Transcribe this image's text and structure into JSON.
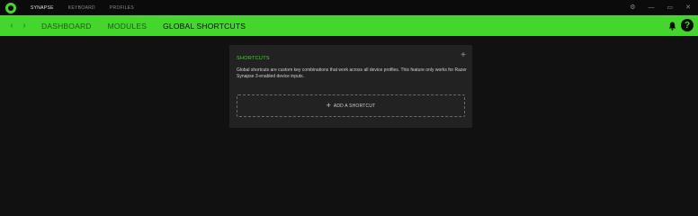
{
  "titlebar": {
    "tabs": [
      {
        "label": "SYNAPSE",
        "active": true
      },
      {
        "label": "KEYBOARD",
        "active": false
      },
      {
        "label": "PROFILES",
        "active": false
      }
    ],
    "controls": {
      "settings": "⚙",
      "minimize": "—",
      "maximize": "▭",
      "close": "✕"
    }
  },
  "nav": {
    "back": "‹",
    "forward": "›",
    "links": [
      {
        "label": "DASHBOARD",
        "active": false
      },
      {
        "label": "MODULES",
        "active": false
      },
      {
        "label": "GLOBAL SHORTCUTS",
        "active": true
      }
    ],
    "help": "?"
  },
  "card": {
    "title": "SHORTCUTS",
    "plus": "+",
    "description": "Global shortcuts are custom key combinations that work across all device profiles. This feature only works for Razer Synapse 3-enabled device inputs.",
    "add_plus": "+",
    "add_label": "ADD A SHORTCUT"
  },
  "colors": {
    "accent": "#44d62c",
    "background": "#111111",
    "card": "#222222"
  }
}
